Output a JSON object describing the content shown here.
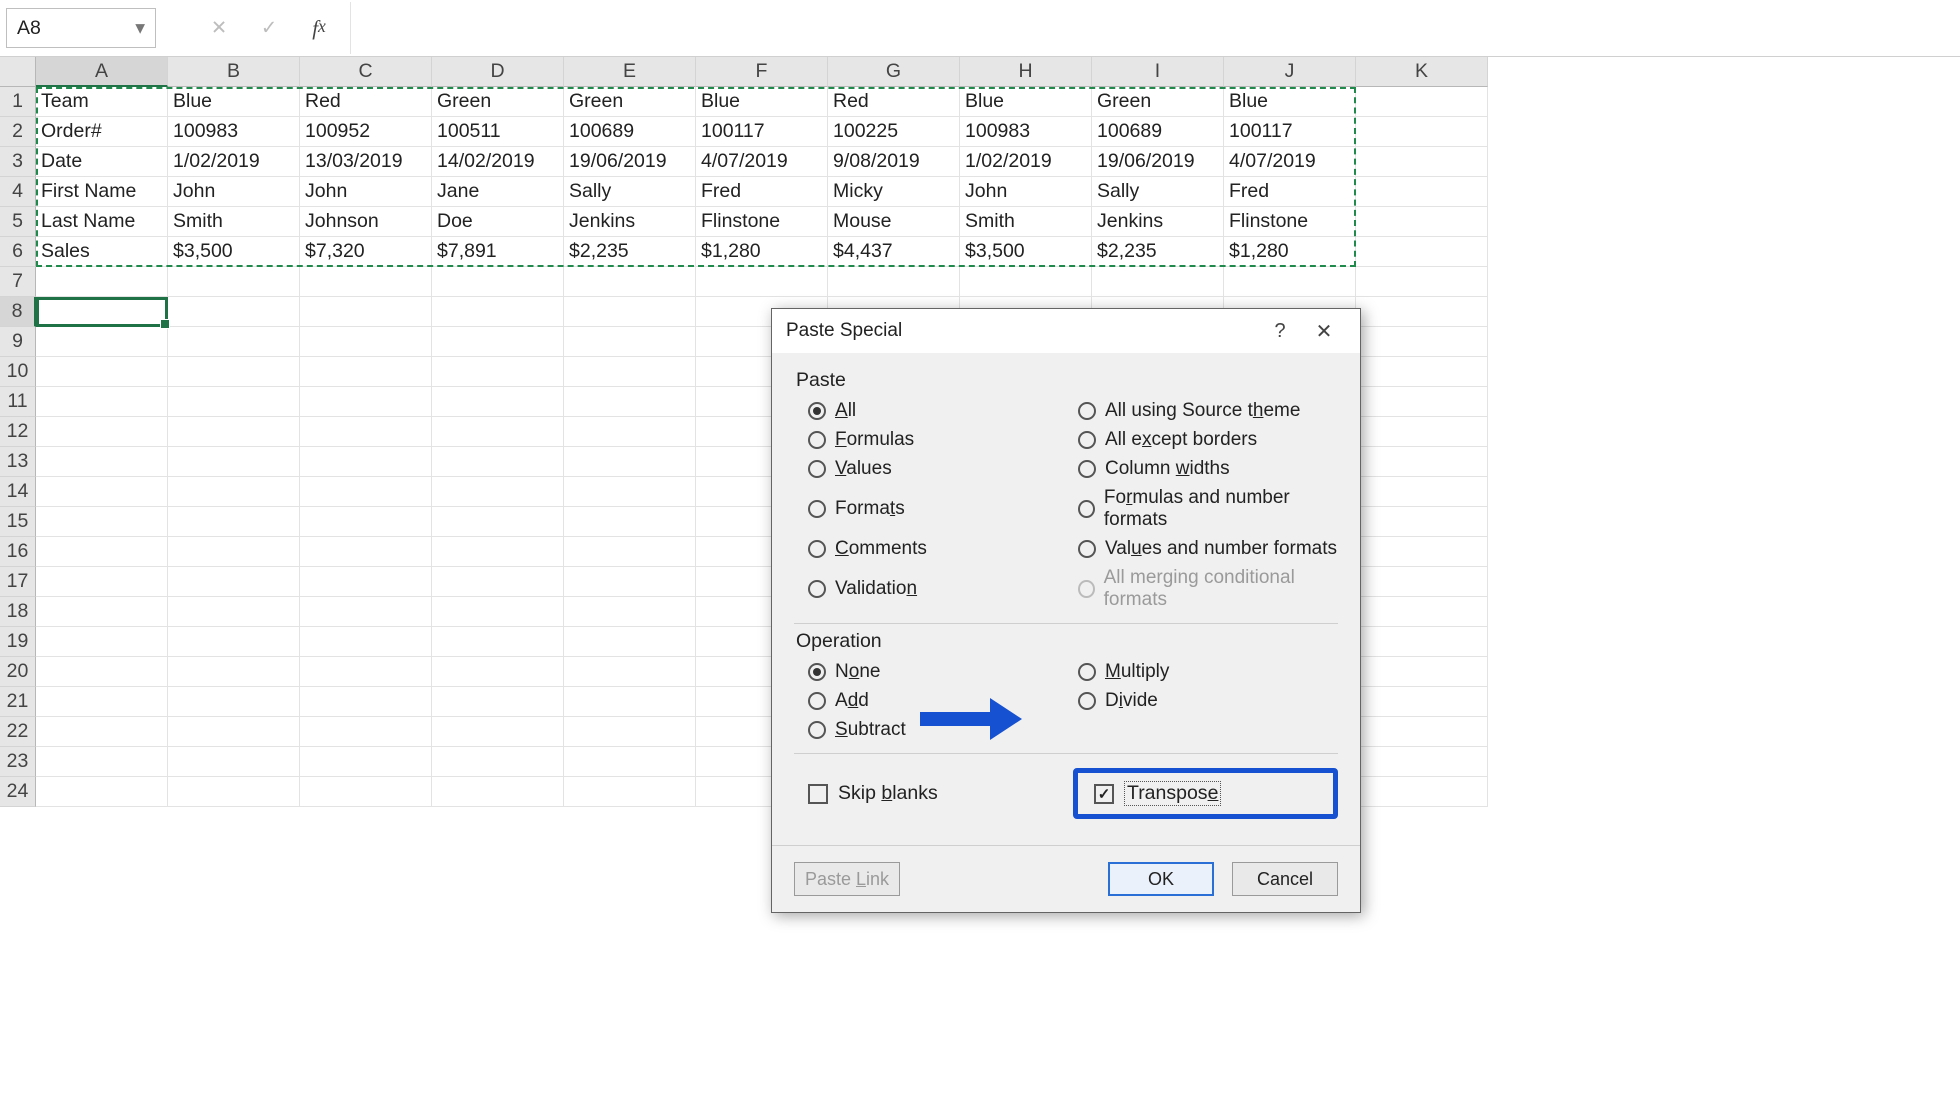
{
  "nameBox": {
    "value": "A8"
  },
  "formulaBar": {
    "value": ""
  },
  "columns": [
    "A",
    "B",
    "C",
    "D",
    "E",
    "F",
    "G",
    "H",
    "I",
    "J",
    "K"
  ],
  "selectedColumnIndex": 0,
  "rowCount": 24,
  "selectedRowIndex": 7,
  "data": {
    "rows": [
      [
        "Team",
        "Blue",
        "Red",
        "Green",
        "Green",
        "Blue",
        "Red",
        "Blue",
        "Green",
        "Blue"
      ],
      [
        "Order#",
        "100983",
        "100952",
        "100511",
        "100689",
        "100117",
        "100225",
        "100983",
        "100689",
        "100117"
      ],
      [
        "Date",
        "1/02/2019",
        "13/03/2019",
        "14/02/2019",
        "19/06/2019",
        "4/07/2019",
        "9/08/2019",
        "1/02/2019",
        "19/06/2019",
        "4/07/2019"
      ],
      [
        "First Name",
        "John",
        "John",
        "Jane",
        "Sally",
        "Fred",
        "Micky",
        "John",
        "Sally",
        "Fred"
      ],
      [
        "Last Name",
        "Smith",
        "Johnson",
        "Doe",
        "Jenkins",
        "Flinstone",
        "Mouse",
        "Smith",
        "Jenkins",
        "Flinstone"
      ],
      [
        "Sales",
        "$3,500",
        "$7,320",
        "$7,891",
        "$2,235",
        "$1,280",
        "$4,437",
        "$3,500",
        "$2,235",
        "$1,280"
      ]
    ]
  },
  "dialog": {
    "title": "Paste Special",
    "sectionPaste": "Paste",
    "sectionOperation": "Operation",
    "paste": {
      "all": "All",
      "formulas": "Formulas",
      "values": "Values",
      "formats": "Formats",
      "comments": "Comments",
      "validation": "Validation",
      "allTheme": "All using Source theme",
      "allExceptBorders": "All except borders",
      "columnWidths": "Column widths",
      "formulasNumFmt": "Formulas and number formats",
      "valuesNumFmt": "Values and number formats",
      "allMergeCond": "All merging conditional formats"
    },
    "operation": {
      "none": "None",
      "add": "Add",
      "subtract": "Subtract",
      "multiply": "Multiply",
      "divide": "Divide"
    },
    "skipBlanks": "Skip blanks",
    "transpose": "Transpose",
    "pasteLink": "Paste Link",
    "ok": "OK",
    "cancel": "Cancel",
    "selectedPaste": "all",
    "selectedOperation": "none",
    "skipBlanksChecked": false,
    "transposeChecked": true
  }
}
